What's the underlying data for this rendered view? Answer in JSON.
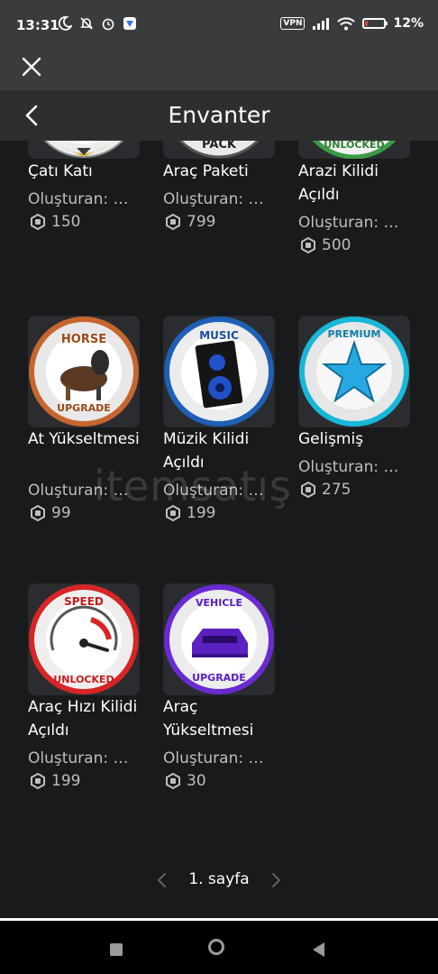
{
  "status_bar": {
    "time": "13:31",
    "vpn": "VPN",
    "battery": "12%",
    "battery_level": 0.12
  },
  "header": {
    "title": "Envanter"
  },
  "items": [
    {
      "name": "Çatı Katı",
      "creator": "Oluşturan: B...",
      "price": "150",
      "thumb_icon": "roof-badge-icon"
    },
    {
      "name": "Araç Paketi",
      "creator": "Oluşturan: B...",
      "price": "799",
      "thumb_icon": "pack-badge-icon",
      "thumb_text": "PACK"
    },
    {
      "name": "Arazi Kilidi Açıldı",
      "creator": "Oluşturan: B...",
      "price": "500",
      "thumb_icon": "unlocked-badge-icon",
      "thumb_text": "UNLOCKED"
    },
    {
      "name": "At Yükseltmesi",
      "creator": "Oluşturan: B...",
      "price": "99",
      "thumb_icon": "horse-upgrade-badge-icon",
      "thumb_top": "HORSE",
      "thumb_bottom": "UPGRADE"
    },
    {
      "name": "Müzik Kilidi Açıldı",
      "creator": "Oluşturan: B...",
      "price": "199",
      "thumb_icon": "music-speaker-badge-icon",
      "thumb_top": "MUSIC"
    },
    {
      "name": "Gelişmiş",
      "creator": "Oluşturan: B...",
      "price": "275",
      "thumb_icon": "premium-star-badge-icon",
      "thumb_top": "PREMIUM"
    },
    {
      "name": "Araç Hızı Kilidi Açıldı",
      "creator": "Oluşturan: B...",
      "price": "199",
      "thumb_icon": "speedometer-badge-icon",
      "thumb_top": "SPEED",
      "thumb_bottom": "UNLOCKED"
    },
    {
      "name": "Araç Yükseltmesi",
      "creator": "Oluşturan: B...",
      "price": "30",
      "thumb_icon": "vehicle-upgrade-badge-icon",
      "thumb_top": "VEHICLE",
      "thumb_bottom": "UPGRADE"
    }
  ],
  "pagination": {
    "label": "1. sayfa"
  },
  "watermark": "itemsatış",
  "colors": {
    "background": "#191a1c",
    "header": "#2c2e30",
    "statusbar": "#393b3d",
    "muted_text": "#bdbec0"
  }
}
